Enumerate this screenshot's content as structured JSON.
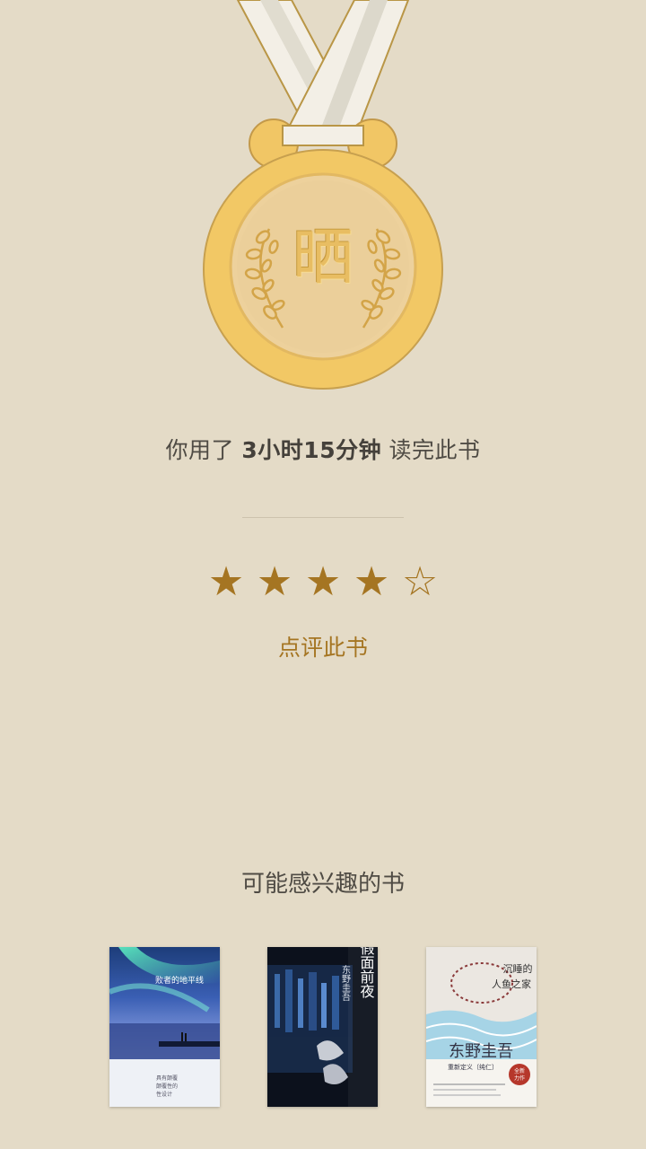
{
  "medal": {
    "character": "晒"
  },
  "reading": {
    "prefix": "你用了",
    "duration": "3小时15分钟",
    "suffix": "读完此书"
  },
  "rating": {
    "value": 4,
    "max": 5,
    "stars": [
      "★",
      "★",
      "★",
      "★",
      "☆"
    ],
    "color": "#a57522"
  },
  "review_button": {
    "label": "点评此书"
  },
  "recommendations": {
    "title": "可能感兴趣的书",
    "books": [
      {
        "title": "败者的地平线",
        "label_lines": [
          "具有颠覆",
          "颠覆性的",
          "性设计"
        ]
      },
      {
        "title": "假面前夜",
        "author": "东野圭吾"
      },
      {
        "title_lines": [
          "沉睡的",
          "人鱼之家"
        ],
        "author": "东野圭吾",
        "subtitle": "重新定义〔纯仁〕",
        "badge_lines": [
          "全新",
          "力作"
        ]
      }
    ]
  }
}
